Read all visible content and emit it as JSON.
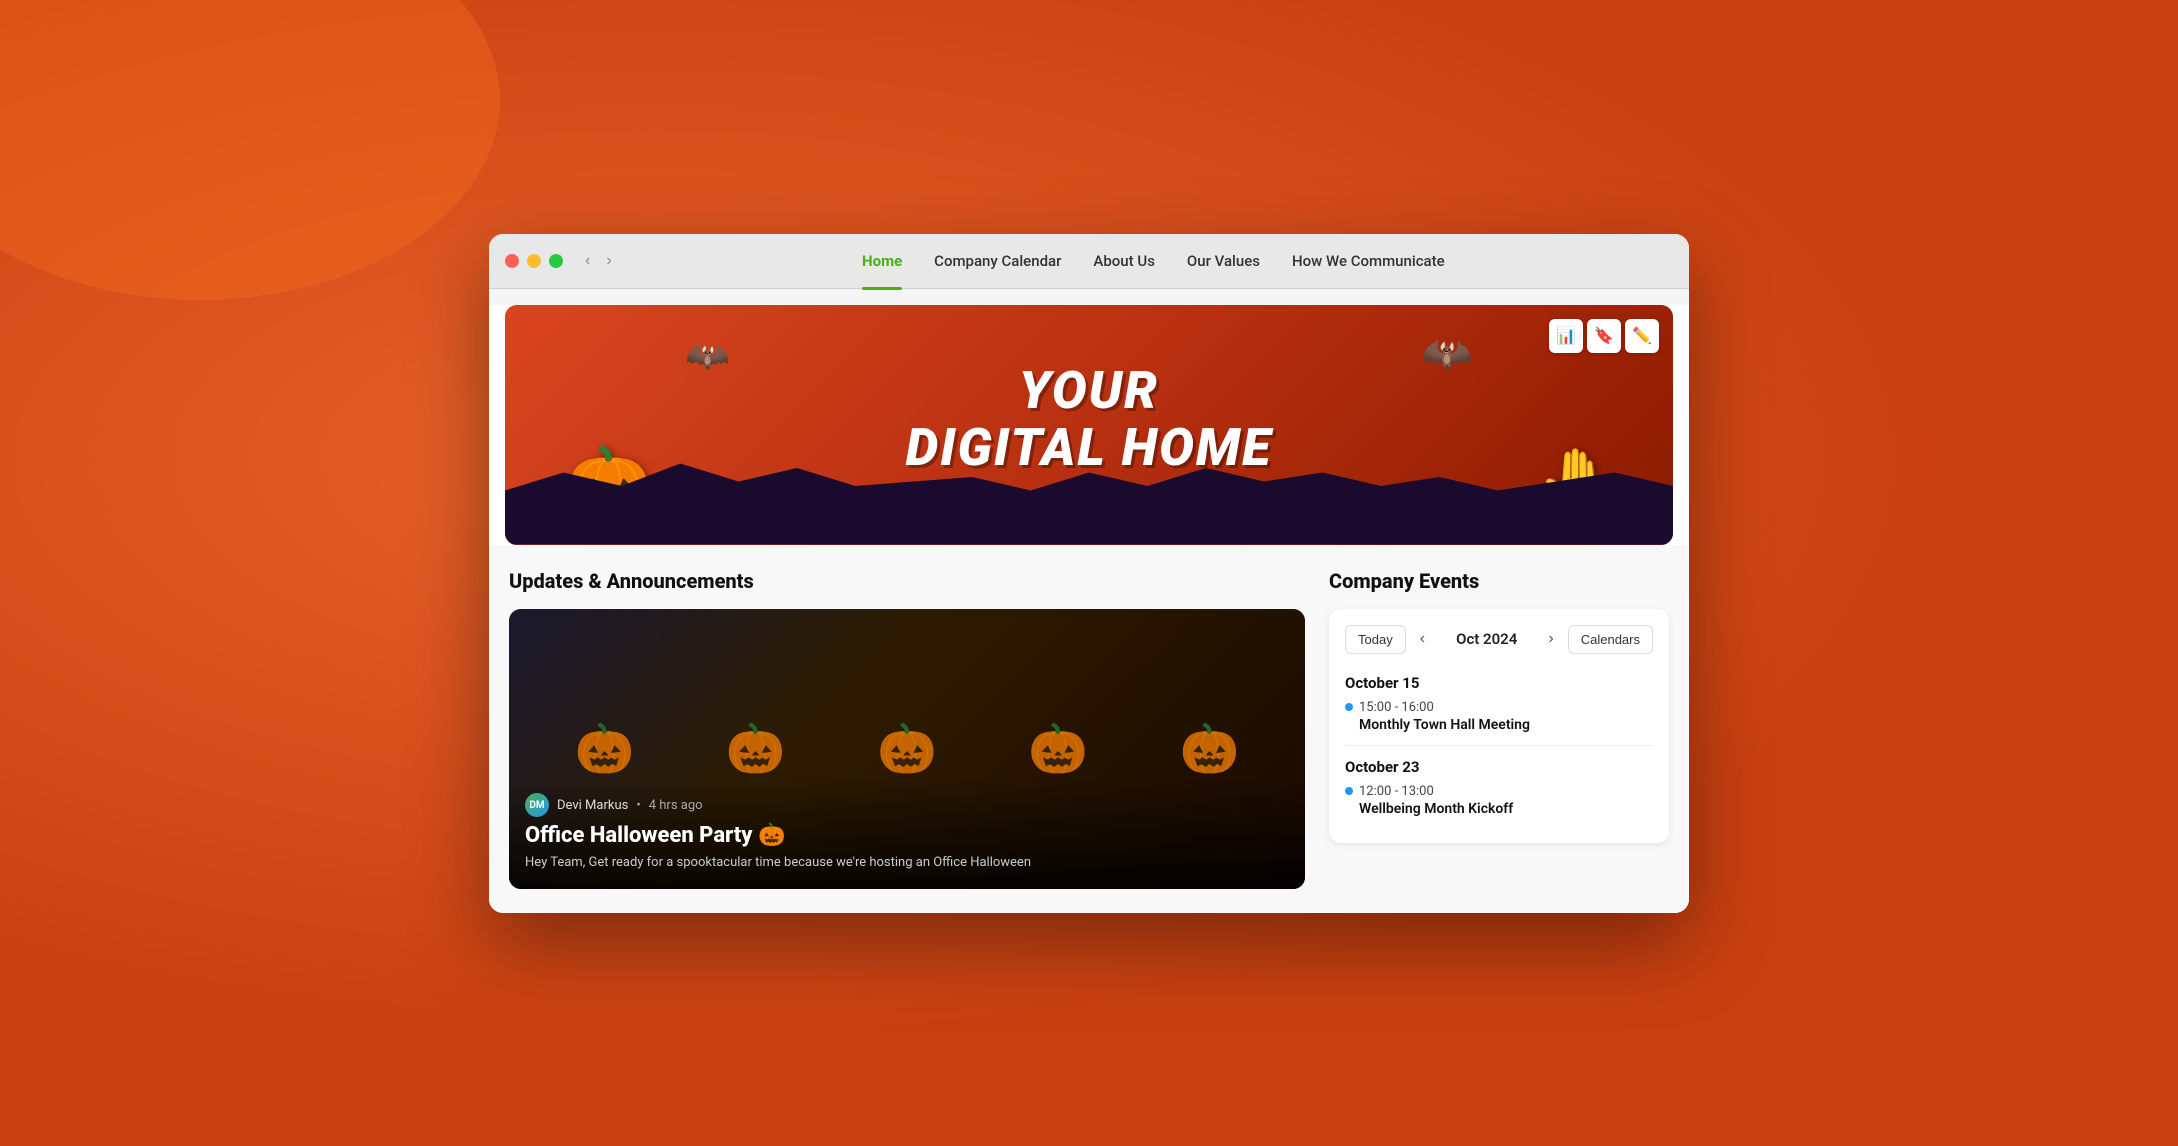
{
  "browser": {
    "traffic_lights": [
      "red",
      "yellow",
      "green"
    ]
  },
  "nav": {
    "items": [
      {
        "label": "Home",
        "active": true
      },
      {
        "label": "Company Calendar",
        "active": false
      },
      {
        "label": "About Us",
        "active": false
      },
      {
        "label": "Our Values",
        "active": false
      },
      {
        "label": "How We Communicate",
        "active": false
      }
    ]
  },
  "hero": {
    "title_line1": "Your",
    "title_line2": "Digital Home",
    "toolbar": {
      "chart_icon": "📊",
      "bookmark_icon": "🔖",
      "edit_icon": "✏️"
    }
  },
  "updates_section": {
    "title": "Updates & Announcements"
  },
  "article": {
    "author": "Devi Markus",
    "time_ago": "4 hrs ago",
    "title": "Office Halloween Party 🎃",
    "excerpt": "Hey Team, Get ready for a spooktacular time because we're hosting an Office Halloween"
  },
  "events_section": {
    "title": "Company Events",
    "calendar_today": "Today",
    "calendar_month": "Oct 2024",
    "calendar_calendars": "Calendars",
    "dates": [
      {
        "date": "October 15",
        "events": [
          {
            "time": "15:00 - 16:00",
            "name": "Monthly Town Hall Meeting"
          }
        ]
      },
      {
        "date": "October 23",
        "events": [
          {
            "time": "12:00 - 13:00",
            "name": "Wellbeing Month Kickoff"
          }
        ]
      }
    ]
  }
}
